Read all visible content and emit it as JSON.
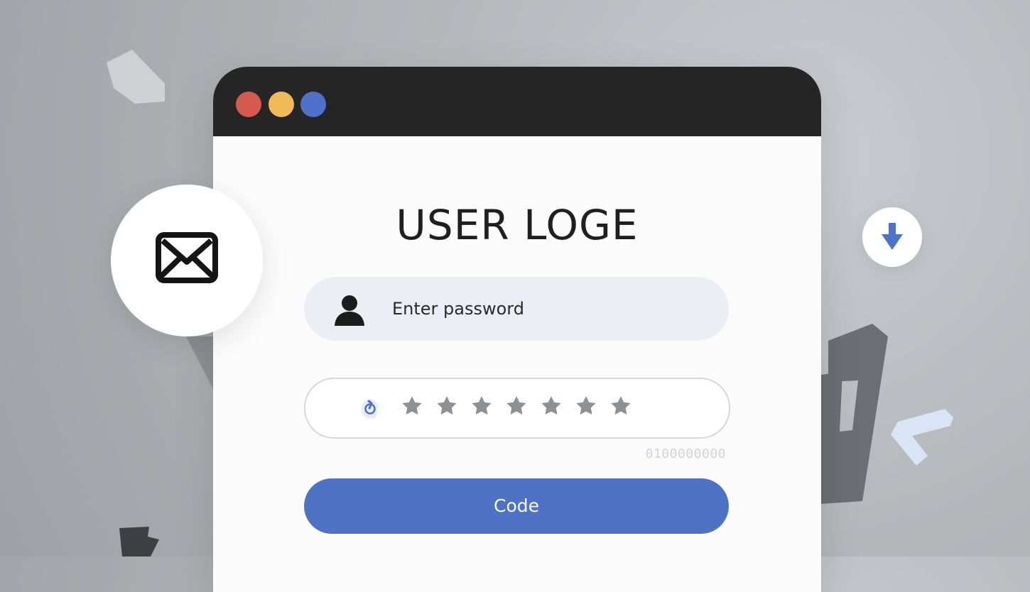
{
  "window": {
    "title": "USER LOGE"
  },
  "login_form": {
    "username_placeholder": "Enter password",
    "password_mask": "★★★★★★★",
    "helper_text": "0100000000",
    "submit_label": "Code"
  },
  "icons": {
    "window_controls": [
      "close-dot",
      "minimize-dot",
      "maximize-dot"
    ],
    "mail": "mail-icon",
    "user": "user-icon",
    "password": "lock-icon",
    "download": "arrow-down-icon"
  },
  "colors": {
    "titlebar": "#252525",
    "accent": "#4f73c4",
    "close": "#d45a4f",
    "minimize": "#efba57",
    "maximize": "#4f71c9",
    "background": "#b6babd"
  }
}
